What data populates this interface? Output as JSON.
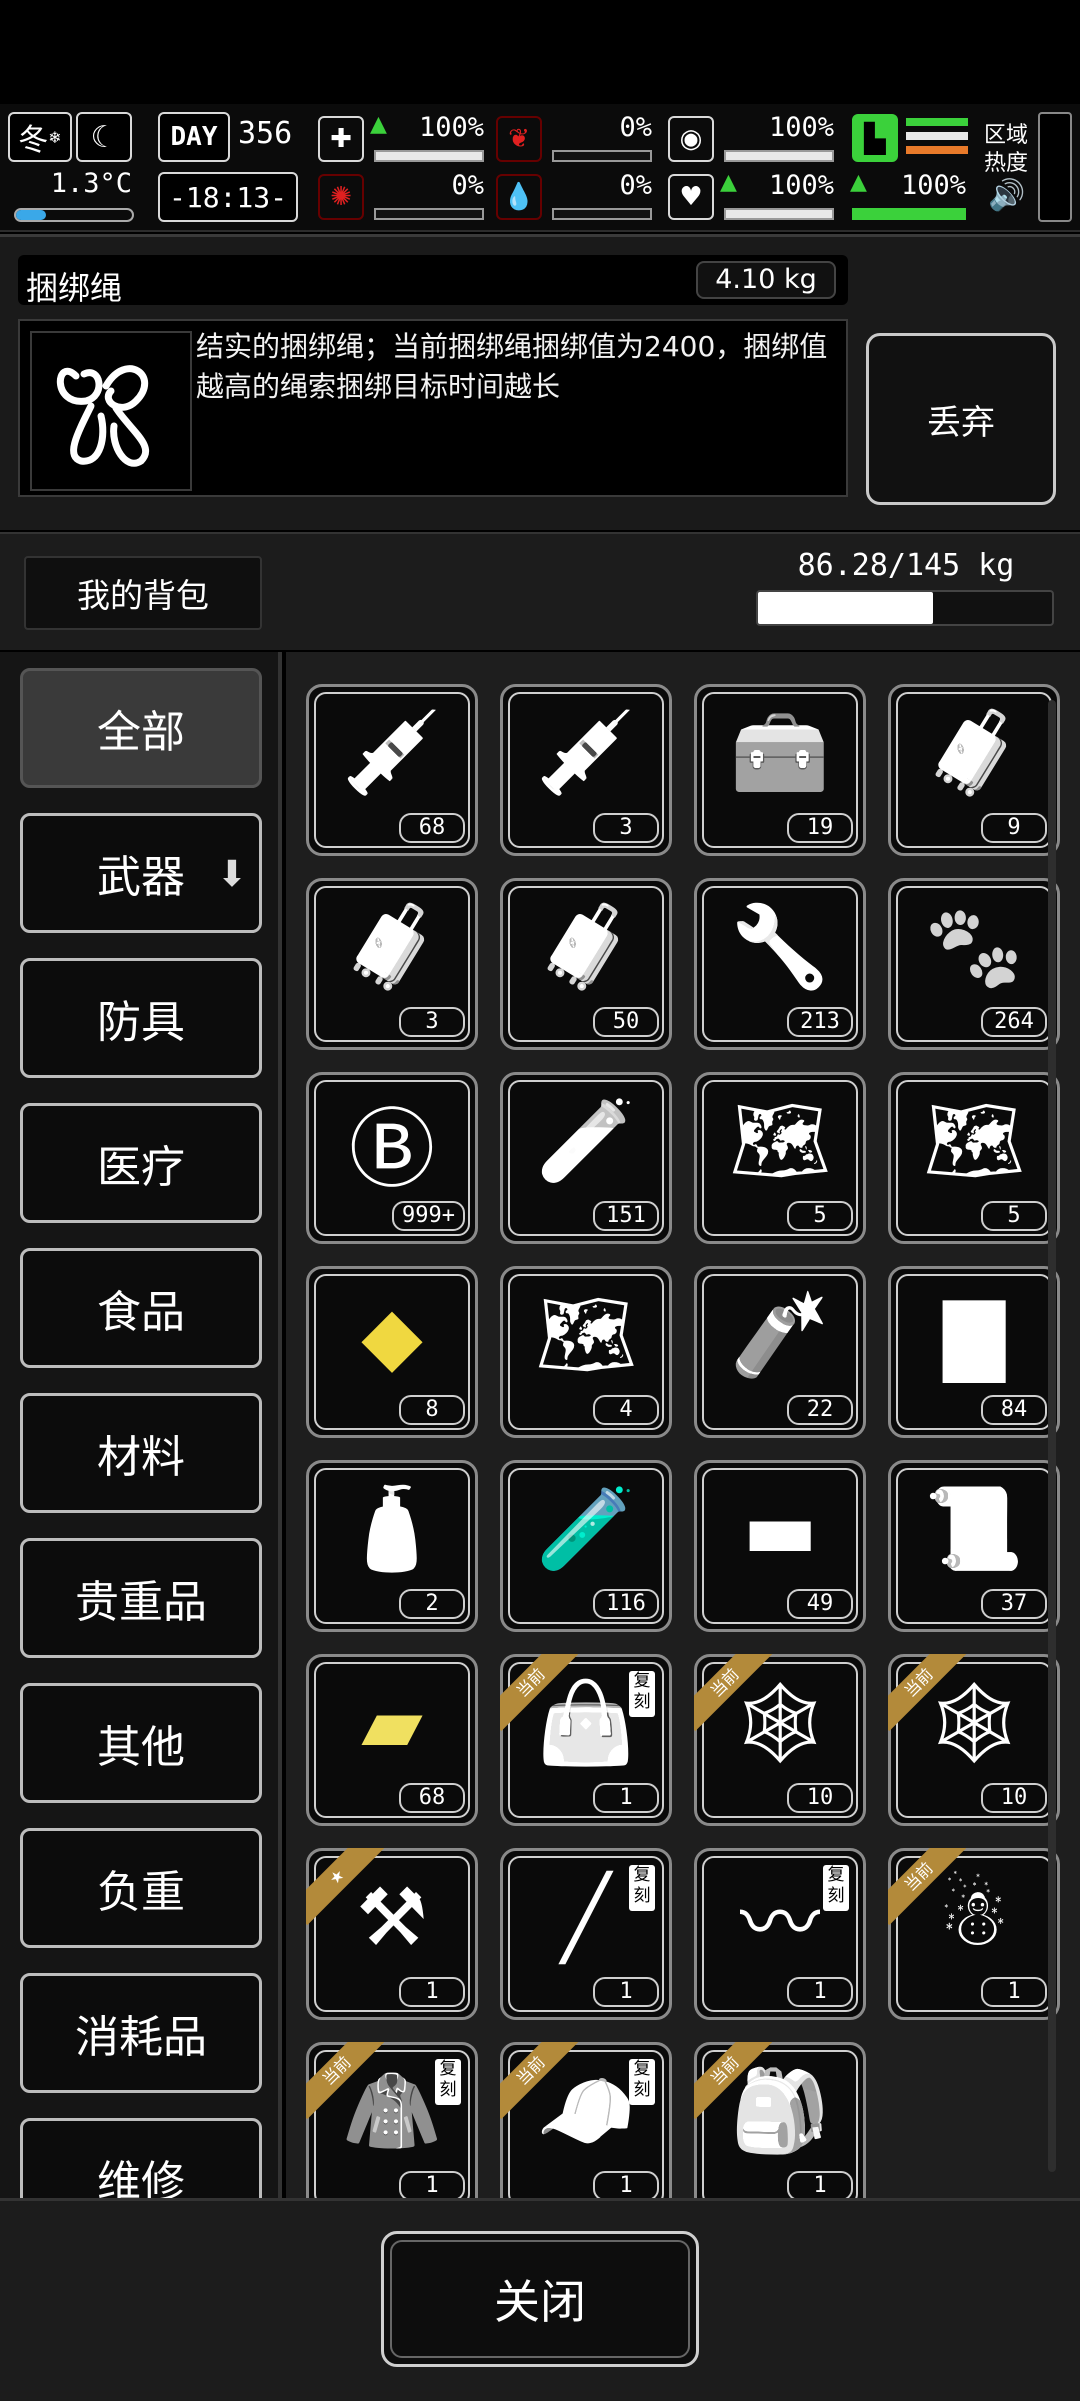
{
  "hud": {
    "season": "冬",
    "temperature": "1.3°C",
    "day_label": "DAY",
    "day": "356",
    "time": "-18:13-",
    "stats": [
      {
        "id": "health",
        "icon": "medkit-icon",
        "value": "100%",
        "fill": 1.0,
        "up": true
      },
      {
        "id": "hunger",
        "icon": "stomach-icon",
        "value": "0%",
        "fill": 0.0,
        "up": false
      },
      {
        "id": "thirst",
        "icon": "lungs-icon",
        "value": "100%",
        "fill": 1.0,
        "up": false
      },
      {
        "id": "infection",
        "icon": "virus-icon",
        "value": "0%",
        "fill": 0.0,
        "up": false
      },
      {
        "id": "bleeding",
        "icon": "blood-drop-icon",
        "value": "0%",
        "fill": 0.0,
        "up": false
      },
      {
        "id": "mood",
        "icon": "heart-icon",
        "value": "100%",
        "fill": 1.0,
        "up": true
      },
      {
        "id": "stamina",
        "icon": "boot-icon",
        "value": "100%",
        "fill": 1.0,
        "up": true
      }
    ],
    "region_heat_label": "区域\n热度"
  },
  "selected_item": {
    "name": "捆绑绳",
    "weight": "4.10 kg",
    "description": "结实的捆绑绳；当前捆绑绳捆绑值为2400，捆绑值越高的绳索捆绑目标时间越长",
    "discard_label": "丢弃"
  },
  "backpack": {
    "title": "我的背包",
    "capacity": "86.28/145 kg",
    "fill": 0.595
  },
  "categories": [
    {
      "label": "全部",
      "active": true
    },
    {
      "label": "武器",
      "active": false,
      "dropdown": true
    },
    {
      "label": "防具",
      "active": false
    },
    {
      "label": "医疗",
      "active": false
    },
    {
      "label": "食品",
      "active": false
    },
    {
      "label": "材料",
      "active": false
    },
    {
      "label": "贵重品",
      "active": false
    },
    {
      "label": "其他",
      "active": false
    },
    {
      "label": "负重",
      "active": false
    },
    {
      "label": "消耗品",
      "active": false
    },
    {
      "label": "维修",
      "active": false
    }
  ],
  "items": [
    {
      "icon": "syringe-icon",
      "count": "68"
    },
    {
      "icon": "syringe-plus-icon",
      "count": "3"
    },
    {
      "icon": "tool-bag-icon",
      "count": "19"
    },
    {
      "icon": "chest-icon",
      "count": "9"
    },
    {
      "icon": "fire-chest-icon",
      "count": "3"
    },
    {
      "icon": "fire-chest-icon",
      "count": "50"
    },
    {
      "icon": "wrench-badge-icon",
      "count": "213"
    },
    {
      "icon": "paw-card-icon",
      "count": "264"
    },
    {
      "icon": "bitcoin-coin-icon",
      "count": "999+"
    },
    {
      "icon": "test-tube-icon",
      "count": "151"
    },
    {
      "icon": "map-lv2-icon",
      "count": "5"
    },
    {
      "icon": "map-lv3-icon",
      "count": "5"
    },
    {
      "icon": "gold-nugget-icon",
      "count": "8"
    },
    {
      "icon": "map-lv1-icon",
      "count": "4"
    },
    {
      "icon": "explosive-can-icon",
      "count": "22"
    },
    {
      "icon": "cloth-icon",
      "count": "84"
    },
    {
      "icon": "spray-bottle-icon",
      "count": "2"
    },
    {
      "icon": "purple-tube-icon",
      "count": "116"
    },
    {
      "icon": "towel-icon",
      "count": "49"
    },
    {
      "icon": "paper-roll-icon",
      "count": "37"
    },
    {
      "icon": "yellow-cloth-icon",
      "count": "68"
    },
    {
      "icon": "bag-icon",
      "count": "1",
      "ribbon": "当前",
      "tag": "复刻"
    },
    {
      "icon": "net-trap-icon",
      "count": "10",
      "ribbon": "当前"
    },
    {
      "icon": "net-trap-icon",
      "count": "10",
      "ribbon": "当前"
    },
    {
      "icon": "shovel-icon",
      "count": "1",
      "ribbon": "★"
    },
    {
      "icon": "spear-icon",
      "count": "1",
      "tag": "复刻"
    },
    {
      "icon": "whip-icon",
      "count": "1",
      "tag": "复刻"
    },
    {
      "icon": "figure-icon",
      "count": "1",
      "ribbon": "当前"
    },
    {
      "icon": "coat-icon",
      "count": "1",
      "ribbon": "当前",
      "tag": "复刻"
    },
    {
      "icon": "cap-icon",
      "count": "1",
      "ribbon": "当前",
      "tag": "复刻"
    },
    {
      "icon": "backpack-roll-icon",
      "count": "1",
      "ribbon": "当前"
    }
  ],
  "close_label": "关闭"
}
